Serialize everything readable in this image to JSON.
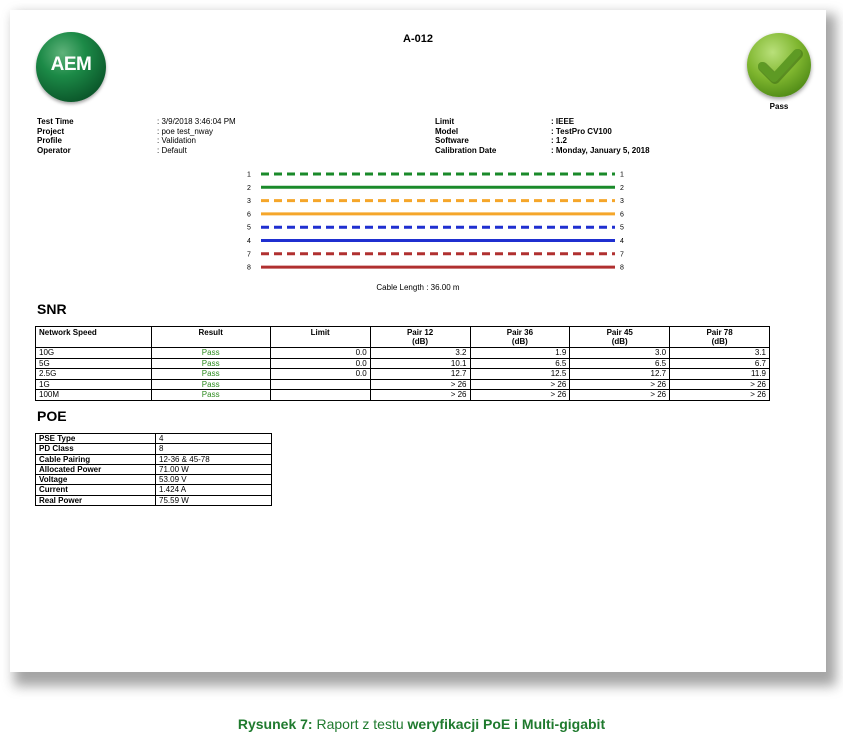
{
  "report": {
    "title": "A-012",
    "logo_text": "AEM",
    "status": "Pass",
    "meta_left": [
      {
        "label": "Test Time",
        "value": ": 3/9/2018 3:46:04 PM"
      },
      {
        "label": "Project",
        "value": ": poe test_nway"
      },
      {
        "label": "Profile",
        "value": ": Validation"
      },
      {
        "label": "Operator",
        "value": ": Default"
      }
    ],
    "meta_right": [
      {
        "label": "Limit",
        "value": ": IEEE"
      },
      {
        "label": "Model",
        "value": ": TestPro CV100"
      },
      {
        "label": "Software",
        "value": ": 1.2"
      },
      {
        "label": "Calibration Date",
        "value": ": Monday, January 5, 2018"
      }
    ],
    "wires": [
      {
        "num": "1",
        "color": "#1a8a2a",
        "style": "dashed"
      },
      {
        "num": "2",
        "color": "#1a8a2a",
        "style": "solid"
      },
      {
        "num": "3",
        "color": "#f5a62a",
        "style": "dashed"
      },
      {
        "num": "6",
        "color": "#f5a62a",
        "style": "solid"
      },
      {
        "num": "5",
        "color": "#1f2fd0",
        "style": "dashed"
      },
      {
        "num": "4",
        "color": "#1f2fd0",
        "style": "solid"
      },
      {
        "num": "7",
        "color": "#b03030",
        "style": "dashed"
      },
      {
        "num": "8",
        "color": "#b03030",
        "style": "solid"
      }
    ],
    "cable_length": "Cable Length : 36.00 m"
  },
  "snr": {
    "heading": "SNR",
    "columns": [
      "Network Speed",
      "Result",
      "Limit",
      "Pair 12\n(dB)",
      "Pair 36\n(dB)",
      "Pair 45\n(dB)",
      "Pair 78\n(dB)"
    ],
    "rows": [
      [
        "10G",
        "Pass",
        "0.0",
        "3.2",
        "1.9",
        "3.0",
        "3.1"
      ],
      [
        "5G",
        "Pass",
        "0.0",
        "10.1",
        "6.5",
        "6.5",
        "6.7"
      ],
      [
        "2.5G",
        "Pass",
        "0.0",
        "12.7",
        "12.5",
        "12.7",
        "11.9"
      ],
      [
        "1G",
        "Pass",
        "",
        "> 26",
        "> 26",
        "> 26",
        "> 26"
      ],
      [
        "100M",
        "Pass",
        "",
        "> 26",
        "> 26",
        "> 26",
        "> 26"
      ]
    ]
  },
  "poe": {
    "heading": "POE",
    "rows": [
      {
        "label": "PSE Type",
        "value": "4"
      },
      {
        "label": "PD Class",
        "value": "8"
      },
      {
        "label": "Cable Pairing",
        "value": "12-36 & 45-78"
      },
      {
        "label": "Allocated Power",
        "value": "71.00 W"
      },
      {
        "label": "Voltage",
        "value": "53.09 V"
      },
      {
        "label": "Current",
        "value": "1.424 A"
      },
      {
        "label": "Real Power",
        "value": "75.59 W"
      }
    ]
  },
  "caption": {
    "prefix": "Rysunek 7: ",
    "part1": "Raport z testu ",
    "part2": "weryfikacji  PoE i Multi-gigabit"
  },
  "colors": {
    "pass_green": "#2e8b20",
    "caption_green": "#1f7a2e"
  }
}
